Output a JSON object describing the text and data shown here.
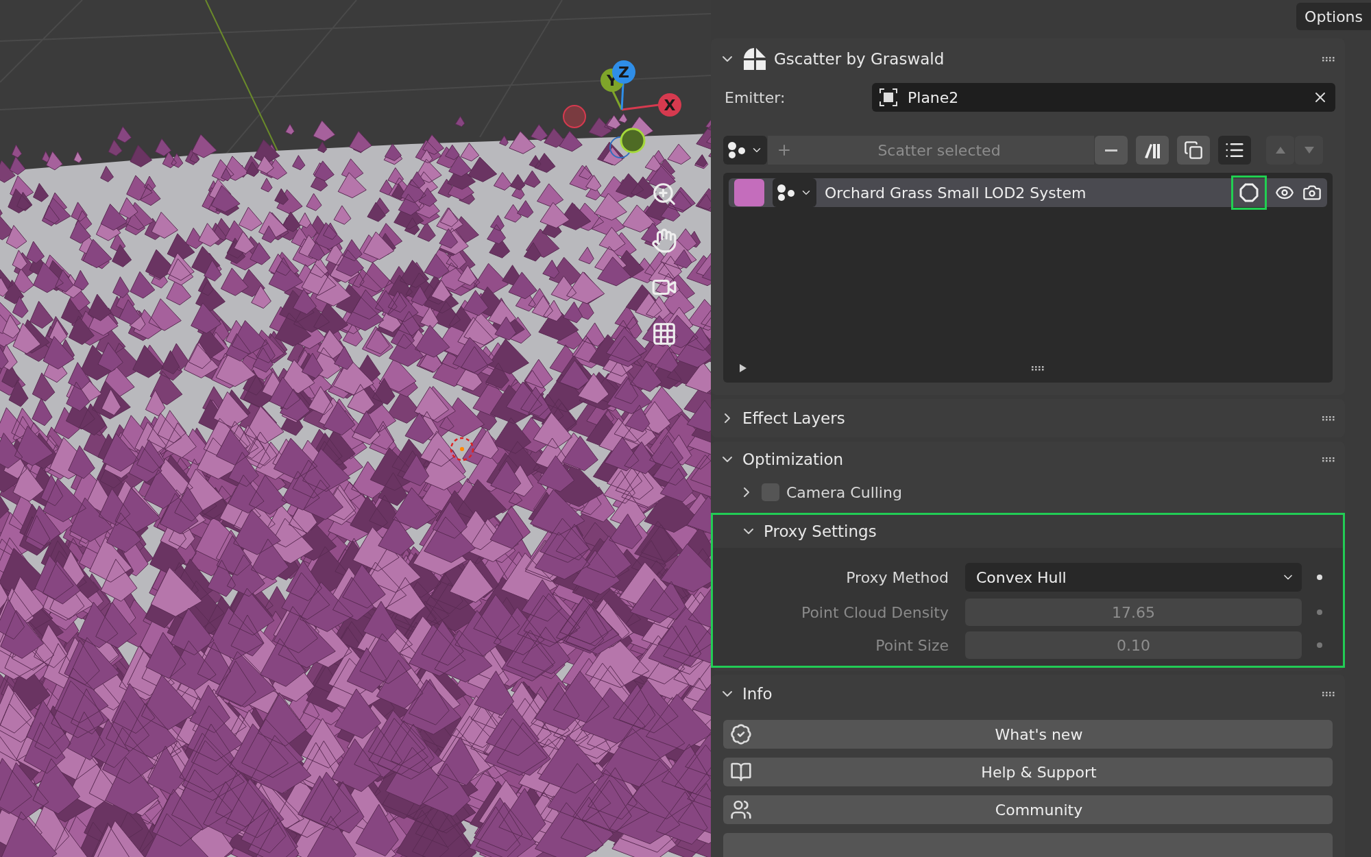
{
  "viewport": {
    "gizmo": [
      {
        "label": "X",
        "color": "#d63a4f"
      },
      {
        "label": "Y",
        "color": "#7fa52a"
      },
      {
        "label": "Z",
        "color": "#2f8ee8"
      }
    ]
  },
  "options_button": "Options",
  "addon_panel": {
    "title": "Gscatter by Graswald",
    "expanded": true,
    "emitter": {
      "label": "Emitter:",
      "value": "Plane2"
    },
    "toolbar": {
      "scatter_button": "Scatter selected",
      "scatter_disabled": true
    },
    "scatter_list": {
      "items": [
        {
          "name": "Orchard Grass Small LOD2 System",
          "color": "#c46dbc",
          "selected": true,
          "proxy_highlighted": true
        }
      ]
    }
  },
  "effect_layers": {
    "title": "Effect Layers",
    "expanded": false
  },
  "optimization": {
    "title": "Optimization",
    "expanded": true,
    "camera_culling": {
      "label": "Camera Culling",
      "checked": false,
      "expanded": false
    },
    "proxy_settings": {
      "title": "Proxy Settings",
      "expanded": true,
      "highlighted": true,
      "fields": [
        {
          "label": "Proxy Method",
          "value": "Convex Hull",
          "kind": "dropdown",
          "disabled": false
        },
        {
          "label": "Point Cloud Density",
          "value": "17.65",
          "kind": "number",
          "disabled": true
        },
        {
          "label": "Point Size",
          "value": "0.10",
          "kind": "number",
          "disabled": true
        }
      ]
    }
  },
  "info": {
    "title": "Info",
    "expanded": true,
    "links": [
      {
        "label": "What's new",
        "kind": "news"
      },
      {
        "label": "Help & Support",
        "kind": "help"
      },
      {
        "label": "Community",
        "kind": "community"
      },
      {
        "kind": "partial"
      }
    ]
  }
}
